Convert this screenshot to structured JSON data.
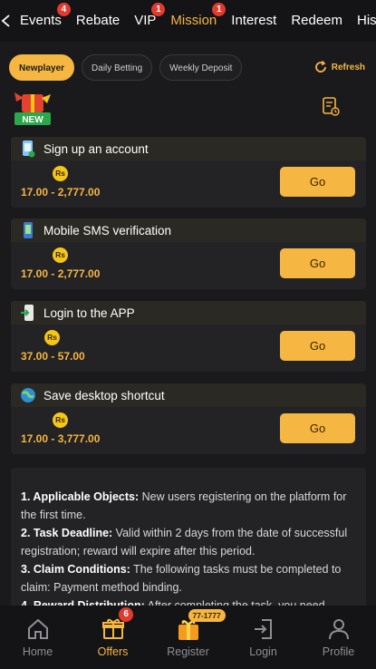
{
  "topnav": {
    "tabs": [
      {
        "label": "Events",
        "badge": "4"
      },
      {
        "label": "Rebate",
        "badge": ""
      },
      {
        "label": "VIP",
        "badge": "1"
      },
      {
        "label": "Mission",
        "badge": "1",
        "active": true
      },
      {
        "label": "Interest",
        "badge": ""
      },
      {
        "label": "Redeem",
        "badge": ""
      },
      {
        "label": "His",
        "badge": ""
      }
    ]
  },
  "filters": {
    "chips": [
      "Newplayer",
      "Daily Betting",
      "Weekly Deposit"
    ],
    "refresh_label": "Refresh"
  },
  "new_badge": "NEW",
  "tasks": [
    {
      "title": "Sign up an account",
      "coin": "Rs",
      "range": "17.00 - 2,777.00",
      "button": "Go",
      "icon": "phone-badge-icon"
    },
    {
      "title": "Mobile SMS verification",
      "coin": "Rs",
      "range": "17.00 - 2,777.00",
      "button": "Go",
      "icon": "mobile-sms-icon"
    },
    {
      "title": "Login to the APP",
      "coin": "Rs",
      "range": "37.00 - 57.00",
      "button": "Go",
      "icon": "login-app-icon"
    },
    {
      "title": "Save desktop shortcut",
      "coin": "Rs",
      "range": "17.00 - 3,777.00",
      "button": "Go",
      "icon": "globe-shortcut-icon"
    }
  ],
  "rules": [
    {
      "head": "1. Applicable Objects:",
      "text": " New users registering on the platform for the first time."
    },
    {
      "head": "2. Task Deadline:",
      "text": " Valid within 2 days from the date of successful registration; reward will expire after this period."
    },
    {
      "head": "3. Claim Conditions:",
      "text": " The following tasks must be completed to claim: Payment method binding."
    },
    {
      "head": "4. Reward Distribution:",
      "text": " After completing the task, you need"
    }
  ],
  "bottomnav": {
    "items": [
      {
        "label": "Home",
        "icon": "home-icon"
      },
      {
        "label": "Offers",
        "icon": "gift-icon",
        "badge": "6",
        "active": true
      },
      {
        "label": "Register",
        "icon": "register-gift-icon",
        "pill": "77-1777"
      },
      {
        "label": "Login",
        "icon": "login-icon"
      },
      {
        "label": "Profile",
        "icon": "profile-icon"
      }
    ]
  },
  "colors": {
    "accent": "#f5b642",
    "badge": "#e33a2f",
    "background": "#1a1a1c"
  }
}
